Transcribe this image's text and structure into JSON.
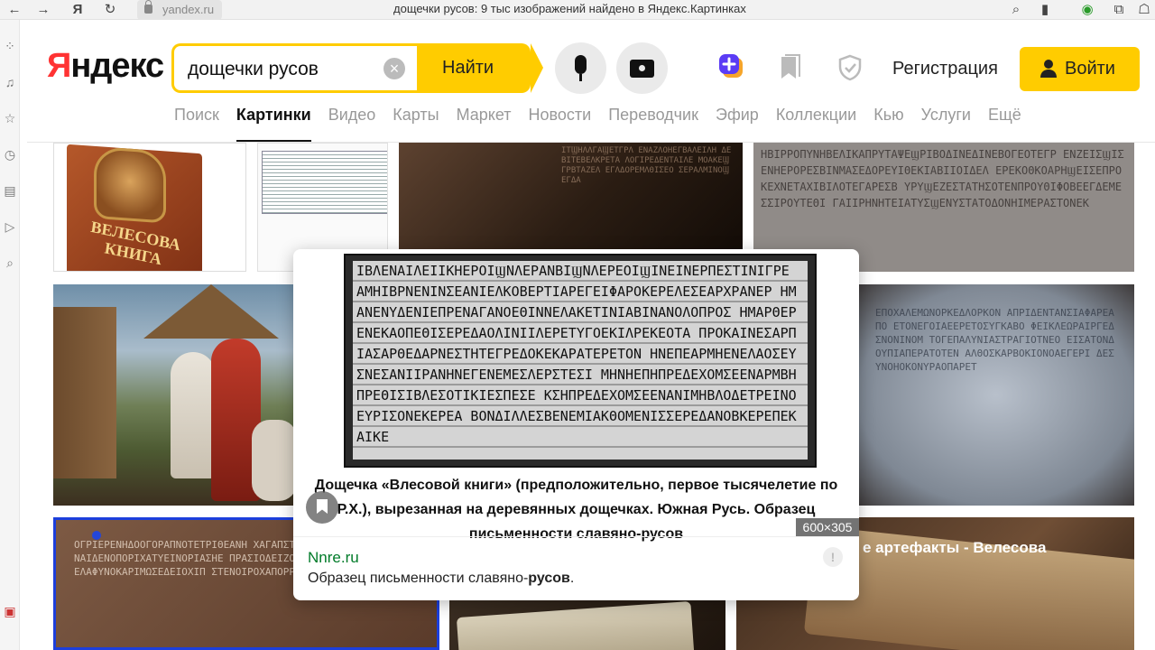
{
  "browser": {
    "url": "yandex.ru",
    "title": "дощечки русов: 9 тыс изображений найдено в Яндекс.Картинках"
  },
  "header": {
    "logo": "Яндекс",
    "logo_first_letter": "Я",
    "logo_rest": "ндекс",
    "search_query": "дощечки русов",
    "search_button": "Найти",
    "register": "Регистрация",
    "login": "Войти"
  },
  "tabs": [
    {
      "label": "Поиск",
      "active": false
    },
    {
      "label": "Картинки",
      "active": true
    },
    {
      "label": "Видео",
      "active": false
    },
    {
      "label": "Карты",
      "active": false
    },
    {
      "label": "Маркет",
      "active": false
    },
    {
      "label": "Новости",
      "active": false
    },
    {
      "label": "Переводчик",
      "active": false
    },
    {
      "label": "Эфир",
      "active": false
    },
    {
      "label": "Коллекции",
      "active": false
    },
    {
      "label": "Кью",
      "active": false
    },
    {
      "label": "Услуги",
      "active": false
    },
    {
      "label": "Ещё",
      "active": false
    }
  ],
  "tiles": {
    "book_title": "ВЕЛЕСОВА КНИГА",
    "brown_title": "е артефакты - Велесова"
  },
  "preview": {
    "caption": "Дощечка «Влесовой книги» (предположительно, первое тысячелетие по Р.Х.), вырезанная на деревянных дощечках. Южная Русь. Образец письменности славяно-русов",
    "size": "600×305",
    "domain": "Nnre.ru",
    "desc_prefix": "Образец письменности славяно-",
    "desc_bold": "русов",
    "desc_suffix": ".",
    "info": "!"
  },
  "colors": {
    "brand_yellow": "#ffcc00",
    "logo_red": "#ff3333",
    "domain_green": "#007b29"
  }
}
